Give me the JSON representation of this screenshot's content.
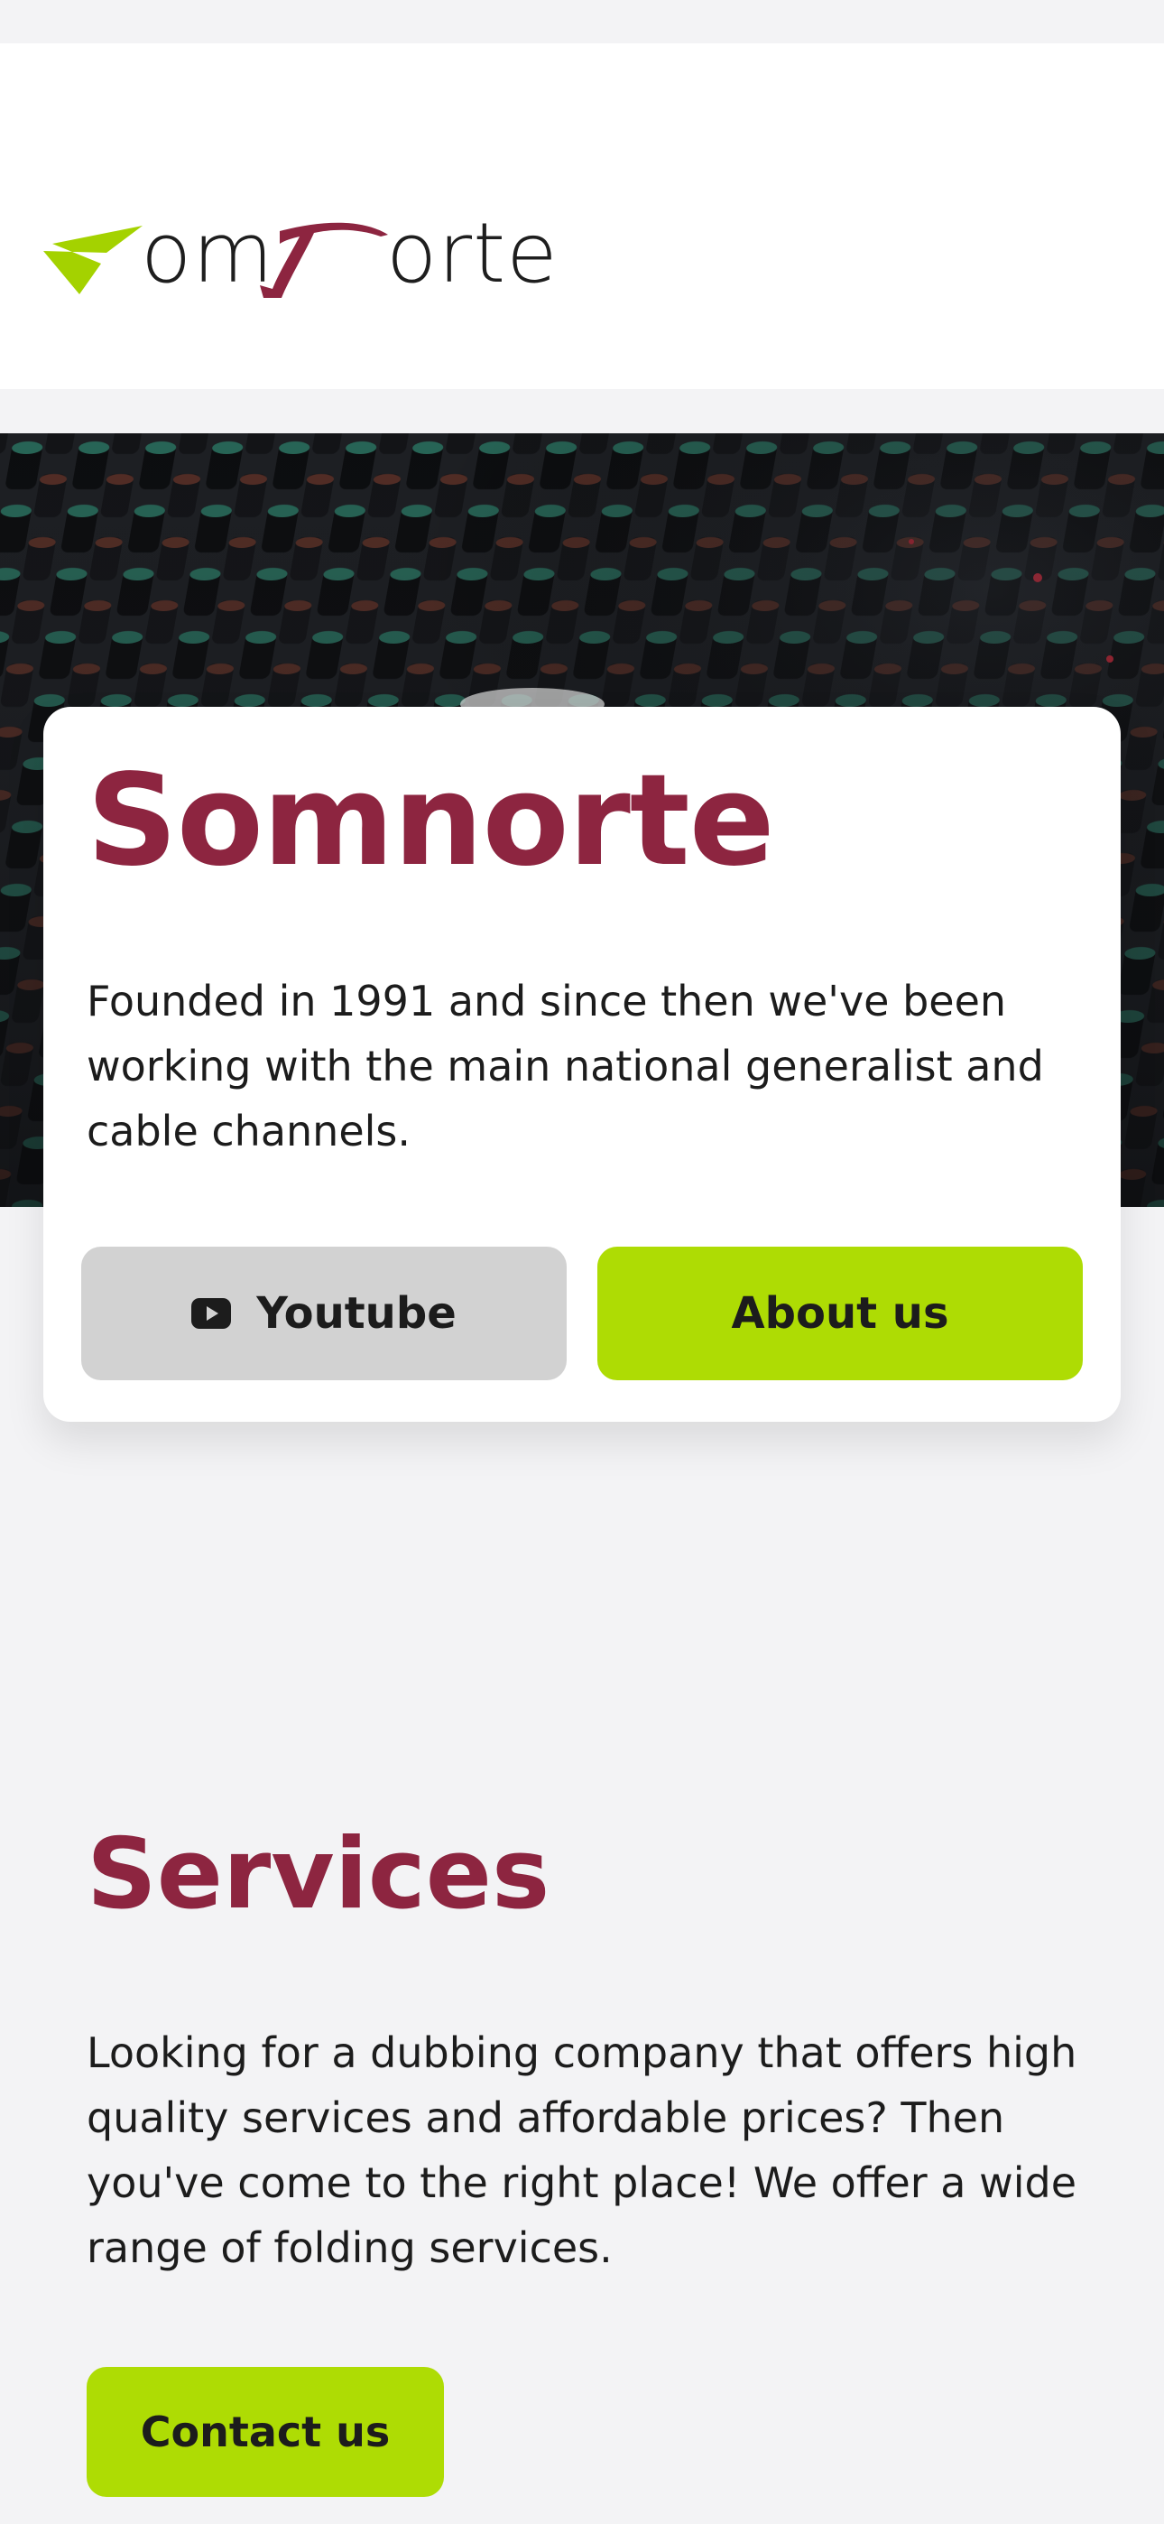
{
  "header": {
    "logo_text_left": "om",
    "logo_text_right": "orte",
    "logo_colors": {
      "accent": "#a4d200",
      "brand": "#8d2540",
      "text": "#1e1e1e"
    }
  },
  "hero": {
    "image_description_icon": "mixing-console-photo"
  },
  "card": {
    "title": "Somnorte",
    "description": "Founded in 1991 and since then we've been working with the main national generalist and cable channels.",
    "buttons": {
      "youtube_label": "Youtube",
      "youtube_icon": "youtube-icon",
      "about_label": "About us"
    }
  },
  "services": {
    "title": "Services",
    "description": "Looking for a dubbing company that offers high quality services and affordable prices? Then you've come to the right place! We offer a wide range of folding services.",
    "contact_label": "Contact us"
  },
  "colors": {
    "page_background": "#f3f3f5",
    "heading": "#8d2540",
    "primary_button": "#aedc04",
    "secondary_button": "#d2d2d2"
  }
}
